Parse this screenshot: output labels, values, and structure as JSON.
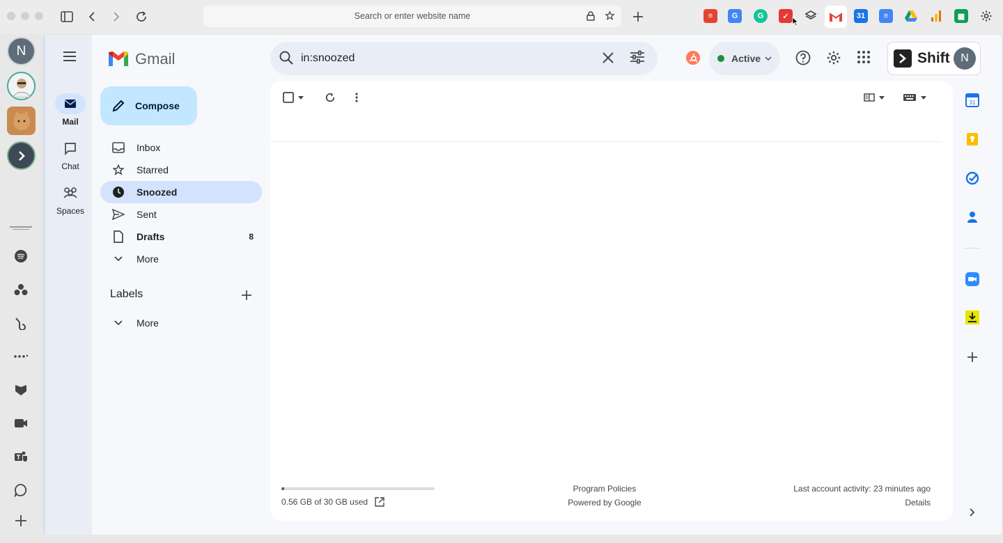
{
  "browser": {
    "url_placeholder": "Search or enter website name"
  },
  "shift": {
    "account_initial": "N",
    "brand": "Shift"
  },
  "gmail": {
    "logo_text": "Gmail",
    "nav_rail": [
      {
        "label": "Mail",
        "icon": "mail-icon"
      },
      {
        "label": "Chat",
        "icon": "chat-icon"
      },
      {
        "label": "Spaces",
        "icon": "spaces-icon"
      }
    ],
    "compose_label": "Compose",
    "folders": [
      {
        "label": "Inbox",
        "icon": "inbox-icon",
        "count": ""
      },
      {
        "label": "Starred",
        "icon": "star-icon",
        "count": ""
      },
      {
        "label": "Snoozed",
        "icon": "clock-icon",
        "count": ""
      },
      {
        "label": "Sent",
        "icon": "send-icon",
        "count": ""
      },
      {
        "label": "Drafts",
        "icon": "draft-icon",
        "count": "8"
      },
      {
        "label": "More",
        "icon": "chevron-down-icon",
        "count": ""
      }
    ],
    "labels_heading": "Labels",
    "labels_more": "More",
    "search_value": "in:snoozed",
    "status": "Active",
    "footer": {
      "storage": "0.56 GB of 30 GB used",
      "storage_fraction": 0.019,
      "policies": "Program Policies",
      "powered": "Powered by Google",
      "last_activity": "Last account activity: 23 minutes ago",
      "details": "Details"
    }
  },
  "colors": {
    "accent": "#0b57d0",
    "compose_bg": "#c2e7ff",
    "active_folder": "#d3e3fd",
    "status_green": "#1e8e3e"
  }
}
